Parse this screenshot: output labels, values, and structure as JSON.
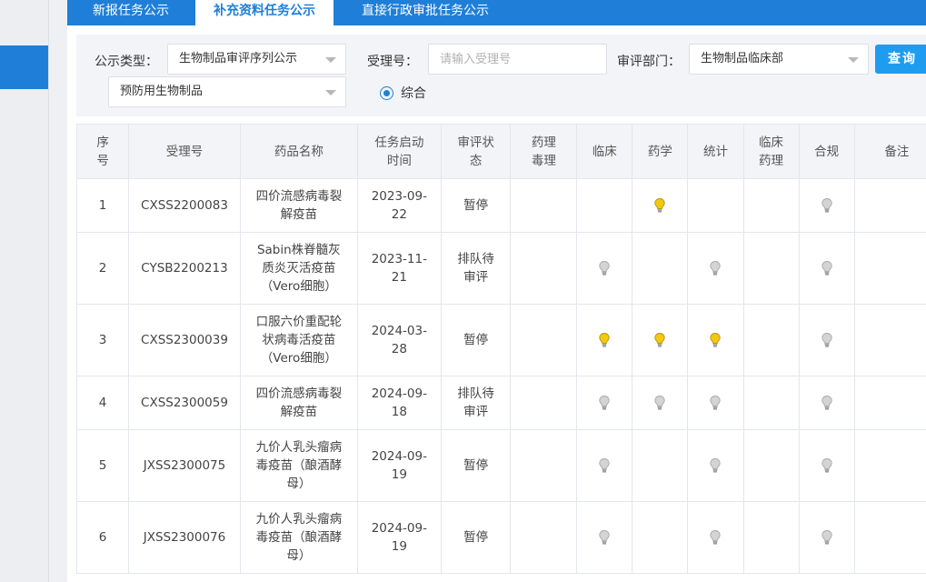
{
  "tabs": [
    {
      "label": "新报任务公示"
    },
    {
      "label": "补充资料任务公示"
    },
    {
      "label": "直接行政审批任务公示"
    }
  ],
  "filters": {
    "type_label": "公示类型：",
    "type_value": "生物制品审评序列公示",
    "accept_label": "受理号：",
    "accept_placeholder": "请输入受理号",
    "dept_label": "审评部门：",
    "dept_value": "生物制品临床部",
    "query_button": "查询",
    "category_value": "预防用生物制品",
    "radio_label": "综合"
  },
  "table": {
    "headers": {
      "seq": [
        "序",
        "号"
      ],
      "accept_no": "受理号",
      "drug_name": "药品名称",
      "start_time": [
        "任务启动",
        "时间"
      ],
      "status": [
        "审评状",
        "态"
      ],
      "pharm_tox": [
        "药理",
        "毒理"
      ],
      "clinical": "临床",
      "pharmacy": "药学",
      "statistics": "统计",
      "clin_pharm": [
        "临床",
        "药理"
      ],
      "compliance": "合规",
      "remarks": "备注"
    },
    "rows": [
      {
        "seq": "1",
        "accept_no": "CXSS2200083",
        "drug_name": [
          "四价流感病毒裂",
          "解疫苗"
        ],
        "start_time": [
          "2023-09-",
          "22"
        ],
        "status": [
          "暂停"
        ],
        "bulbs": {
          "clinical": "",
          "pharmacy": "lit",
          "statistics": "",
          "compliance": "off"
        }
      },
      {
        "seq": "2",
        "accept_no": "CYSB2200213",
        "drug_name": [
          "Sabin株脊髓灰",
          "质炎灭活疫苗",
          "（Vero细胞）"
        ],
        "start_time": [
          "2023-11-",
          "21"
        ],
        "status": [
          "排队待",
          "审评"
        ],
        "bulbs": {
          "clinical": "off",
          "pharmacy": "",
          "statistics": "off",
          "compliance": "off"
        }
      },
      {
        "seq": "3",
        "accept_no": "CXSS2300039",
        "drug_name": [
          "口服六价重配轮",
          "状病毒活疫苗",
          "（Vero细胞）"
        ],
        "start_time": [
          "2024-03-",
          "28"
        ],
        "status": [
          "暂停"
        ],
        "bulbs": {
          "clinical": "lit",
          "pharmacy": "lit",
          "statistics": "lit",
          "compliance": "off"
        }
      },
      {
        "seq": "4",
        "accept_no": "CXSS2300059",
        "drug_name": [
          "四价流感病毒裂",
          "解疫苗"
        ],
        "start_time": [
          "2024-09-",
          "18"
        ],
        "status": [
          "排队待",
          "审评"
        ],
        "bulbs": {
          "clinical": "off",
          "pharmacy": "off",
          "statistics": "off",
          "compliance": "off"
        }
      },
      {
        "seq": "5",
        "accept_no": "JXSS2300075",
        "drug_name": [
          "九价人乳头瘤病",
          "毒疫苗（酿酒酵",
          "母）"
        ],
        "start_time": [
          "2024-09-",
          "19"
        ],
        "status": [
          "暂停"
        ],
        "bulbs": {
          "clinical": "off",
          "pharmacy": "",
          "statistics": "off",
          "compliance": "off"
        }
      },
      {
        "seq": "6",
        "accept_no": "JXSS2300076",
        "drug_name": [
          "九价人乳头瘤病",
          "毒疫苗（酿酒酵",
          "母）"
        ],
        "start_time": [
          "2024-09-",
          "19"
        ],
        "status": [
          "暂停"
        ],
        "bulbs": {
          "clinical": "off",
          "pharmacy": "",
          "statistics": "off",
          "compliance": "off"
        }
      }
    ]
  },
  "colors": {
    "primary": "#1f7fd8",
    "button": "#1f9cf0",
    "bulb_lit": "#f2c811",
    "bulb_off": "#d4d4d4"
  }
}
